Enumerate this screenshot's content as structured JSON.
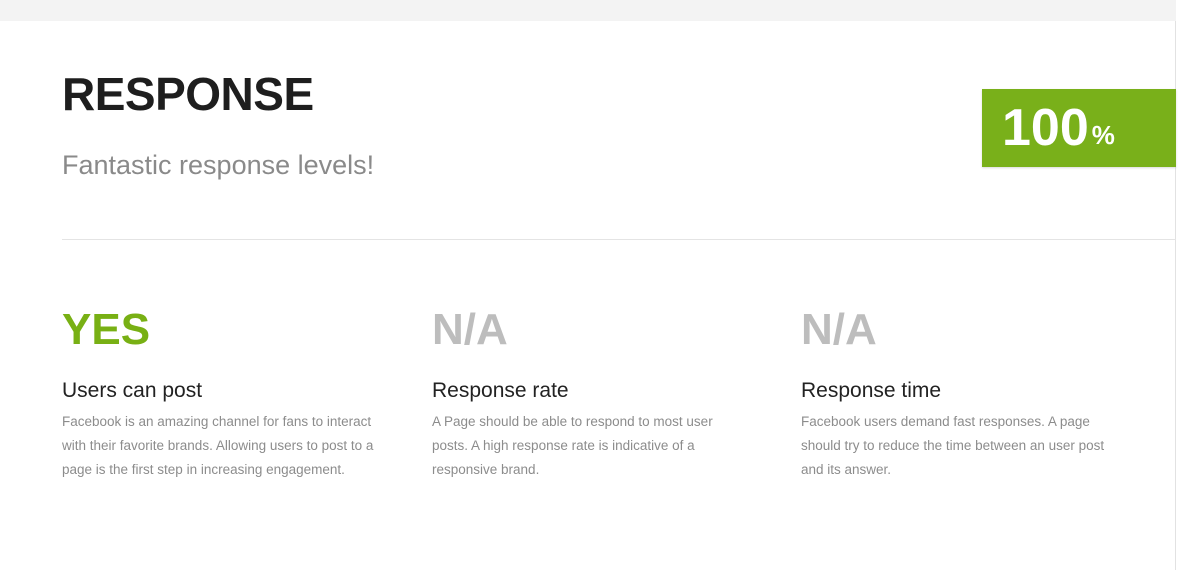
{
  "section": {
    "title": "RESPONSE",
    "subtitle": "Fantastic response levels!",
    "score": {
      "value": "100",
      "unit": "%",
      "color": "#79b01a"
    }
  },
  "metrics": [
    {
      "value": "YES",
      "label": "Users can post",
      "description": "Facebook is an amazing channel for fans to interact with their favorite brands. Allowing users to post to a page is the first step in increasing engagement."
    },
    {
      "value": "N/A",
      "label": "Response rate",
      "description": "A Page should be able to respond to most user posts. A high response rate is indicative of a responsive brand."
    },
    {
      "value": "N/A",
      "label": "Response time",
      "description": "Facebook users demand fast responses. A page should try to reduce the time between an user post and its answer."
    }
  ],
  "colors": {
    "positive": "#78b014",
    "neutral": "#bdbdbd"
  }
}
